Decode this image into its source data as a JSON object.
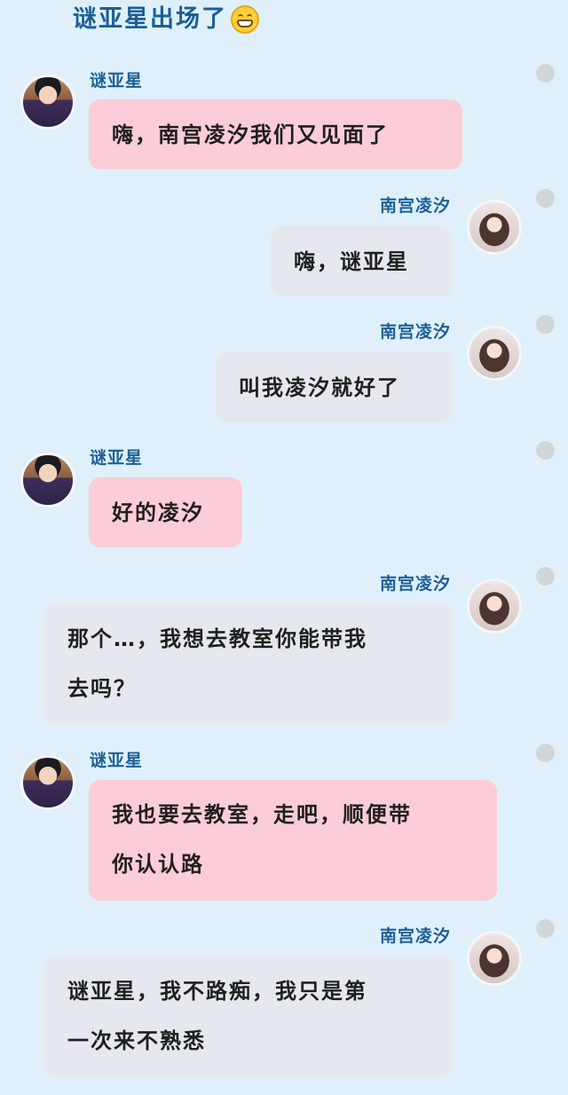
{
  "header": {
    "title": "谜亚星出场了",
    "emoji": "grinning-face"
  },
  "messages": [
    {
      "sender": "谜亚星",
      "side": "left",
      "lines": [
        "嗨，南宫凌汐我们又见面了"
      ]
    },
    {
      "sender": "南宫凌汐",
      "side": "right",
      "lines": [
        "嗨，谜亚星"
      ]
    },
    {
      "sender": "南宫凌汐",
      "side": "right",
      "lines": [
        "叫我凌汐就好了"
      ]
    },
    {
      "sender": "谜亚星",
      "side": "left",
      "lines": [
        "好的凌汐"
      ]
    },
    {
      "sender": "南宫凌汐",
      "side": "right",
      "lines": [
        "那个…，我想去教室你能带我",
        "去吗？"
      ]
    },
    {
      "sender": "谜亚星",
      "side": "left",
      "lines": [
        "我也要去教室，走吧，顺便带",
        "你认认路"
      ]
    },
    {
      "sender": "南宫凌汐",
      "side": "right",
      "lines": [
        "谜亚星，我不路痴，我只是第",
        "一次来不熟悉"
      ]
    }
  ],
  "colors": {
    "background": "#dff0fb",
    "name_text": "#1d5f95",
    "left_bubble": "#fbcdd8",
    "right_bubble": "#e5e8ee",
    "status_dot": "#cfd7db"
  }
}
